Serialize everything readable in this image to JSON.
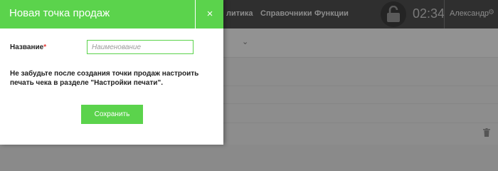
{
  "modal": {
    "title": "Новая точка продаж",
    "close_glyph": "×",
    "name_label": "Название",
    "required_mark": "*",
    "name_placeholder": "Наименование",
    "name_value": "",
    "note": "Не забудьте после создания точки продаж настроить печать чека в разделе \"Настройки печати\".",
    "save_label": "Сохранить"
  },
  "background": {
    "nav": [
      "литика",
      "Справочники",
      "Функции"
    ],
    "clock": "02:34",
    "user": "Александр",
    "icons": [
      "lock-icon",
      "gear-icon",
      "chevron-down-icon",
      "trash-icon"
    ]
  },
  "colors": {
    "accent": "#5bd34c",
    "required": "#e53935",
    "topbar": "#2f2f2f"
  }
}
